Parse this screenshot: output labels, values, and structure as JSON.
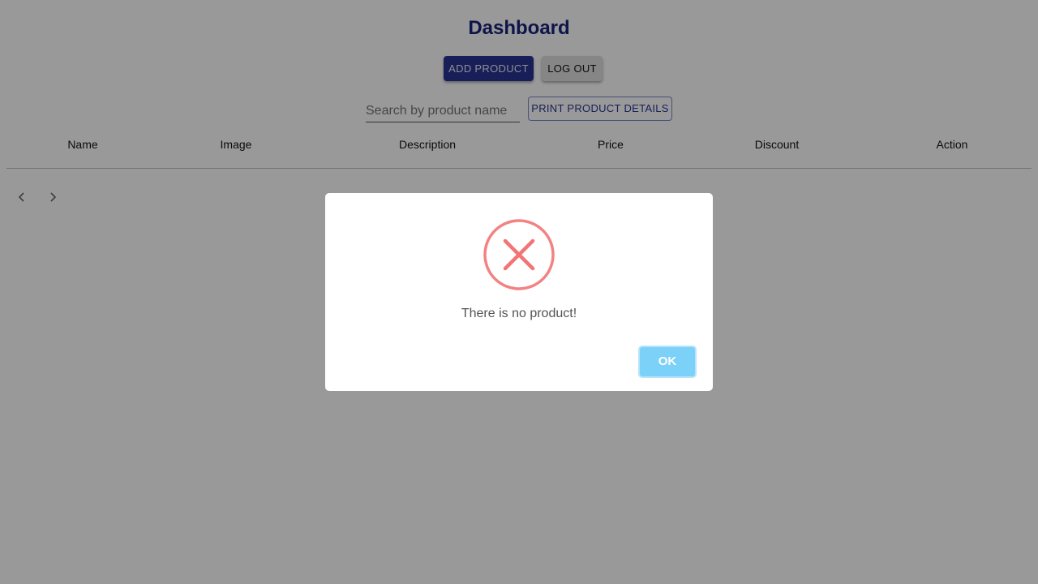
{
  "header": {
    "title": "Dashboard",
    "add_product_label": "ADD PRODUCT",
    "logout_label": "LOG OUT"
  },
  "search": {
    "placeholder": "Search by product name",
    "value": ""
  },
  "print_button_label": "PRINT PRODUCT DETAILS",
  "table": {
    "columns": [
      "Name",
      "Image",
      "Description",
      "Price",
      "Discount",
      "Action"
    ],
    "rows": []
  },
  "pagination": {
    "prev_icon": "chevron-left-icon",
    "next_icon": "chevron-right-icon"
  },
  "alert": {
    "icon": "error-x-icon",
    "message": "There is no product!",
    "ok_label": "OK",
    "colors": {
      "icon": "#f27474",
      "ok_button": "#7cd1f9"
    }
  },
  "colors": {
    "primary": "#283593",
    "title": "#1a237e"
  }
}
